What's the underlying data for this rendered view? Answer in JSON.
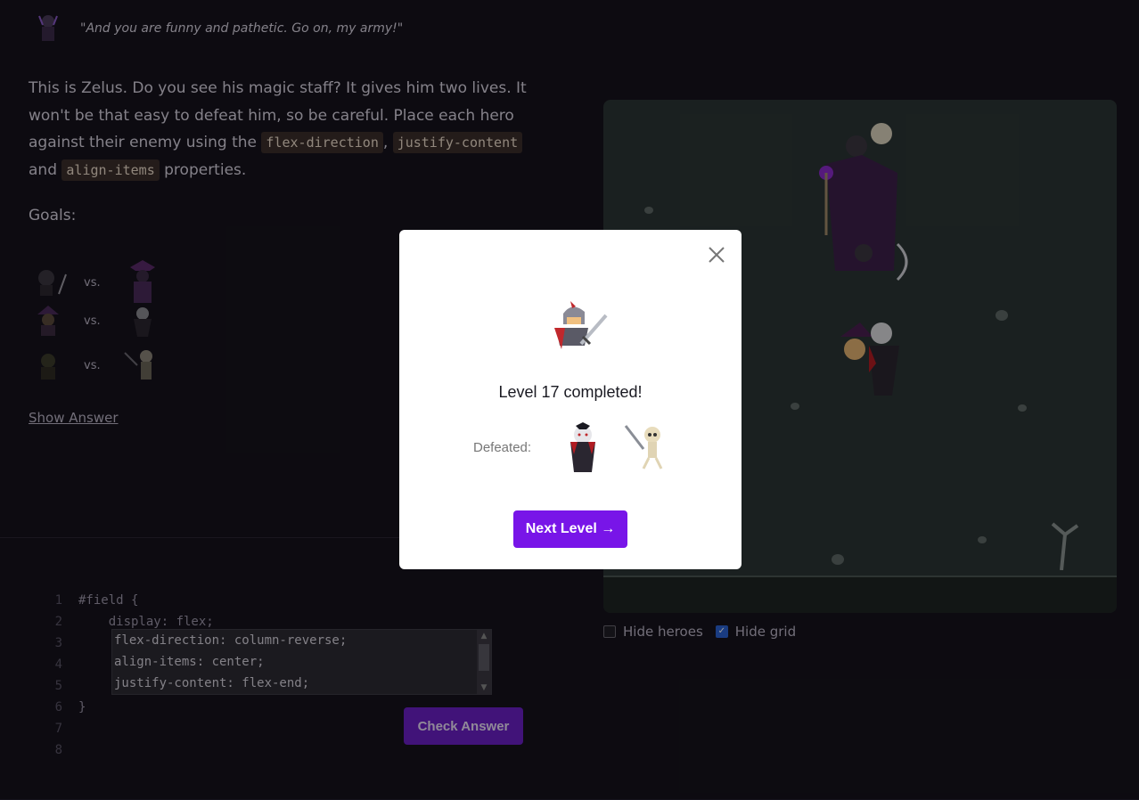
{
  "quote": {
    "text": "\"And you are funny and pathetic. Go on, my army!\""
  },
  "description": {
    "text_1": "This is Zelus. Do you see his magic staff? It gives him two lives. It won't be that easy to defeat him, so be careful. Place each hero against their enemy using the ",
    "code_1": "flex-direction",
    "sep_1": ", ",
    "code_2": "justify-content",
    "text_2": " and ",
    "code_3": "align-items",
    "text_3": " properties."
  },
  "goals": {
    "label": "Goals:",
    "vs": "vs."
  },
  "show_answer": "Show Answer",
  "editor": {
    "line_numbers": [
      "1",
      "2",
      "3",
      "4",
      "5",
      "6",
      "7",
      "8"
    ],
    "pre_lines": "#field {\n    display: flex;",
    "user_lines": "flex-direction: column-reverse;\nalign-items: center;\njustify-content: flex-end;",
    "post_lines": "}",
    "check_button": "Check Answer"
  },
  "options": {
    "hide_heroes": "Hide heroes",
    "hide_grid": "Hide grid",
    "hide_heroes_checked": false,
    "hide_grid_checked": true
  },
  "modal": {
    "title": "Level 17 completed!",
    "defeated_label": "Defeated:",
    "next_button": "Next Level →",
    "close_icon": "close-icon",
    "hero_icon": "knight-hero-icon",
    "enemy_icons": [
      "vampire-enemy-icon",
      "skeleton-enemy-icon"
    ]
  }
}
